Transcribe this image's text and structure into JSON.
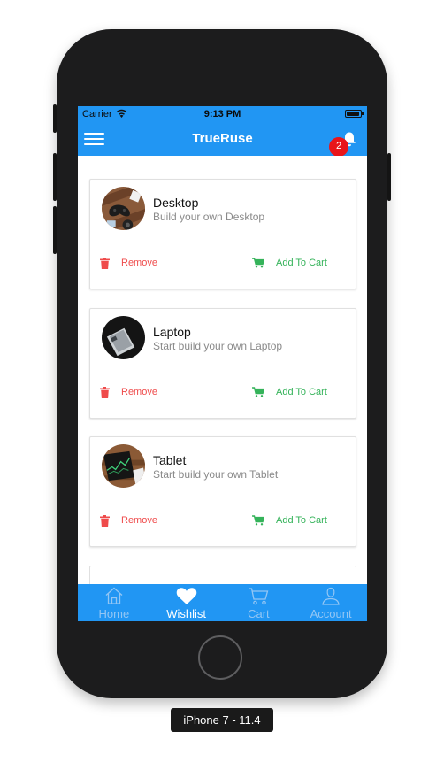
{
  "status_bar": {
    "carrier": "Carrier",
    "time": "9:13 PM"
  },
  "header": {
    "title": "TrueRuse",
    "notification_count": "2"
  },
  "wishlist": [
    {
      "title": "Desktop",
      "subtitle": "Build your own Desktop",
      "image_icon": "desktop-photo",
      "remove_label": "Remove",
      "cart_label": "Add To Cart"
    },
    {
      "title": "Laptop",
      "subtitle": "Start build your own Laptop",
      "image_icon": "laptop-photo",
      "remove_label": "Remove",
      "cart_label": "Add To Cart"
    },
    {
      "title": "Tablet",
      "subtitle": "Start build your own Tablet",
      "image_icon": "tablet-photo",
      "remove_label": "Remove",
      "cart_label": "Add To Cart"
    }
  ],
  "tabs": [
    {
      "label": "Home",
      "icon": "home-icon",
      "active": false
    },
    {
      "label": "Wishlist",
      "icon": "heart-icon",
      "active": true
    },
    {
      "label": "Cart",
      "icon": "cart-icon",
      "active": false
    },
    {
      "label": "Account",
      "icon": "user-icon",
      "active": false
    }
  ],
  "device_label": "iPhone 7 - 11.4",
  "colors": {
    "primary": "#2196f3",
    "remove": "#ef4b4b",
    "add_to_cart": "#35b35a",
    "badge": "#e8151b"
  }
}
